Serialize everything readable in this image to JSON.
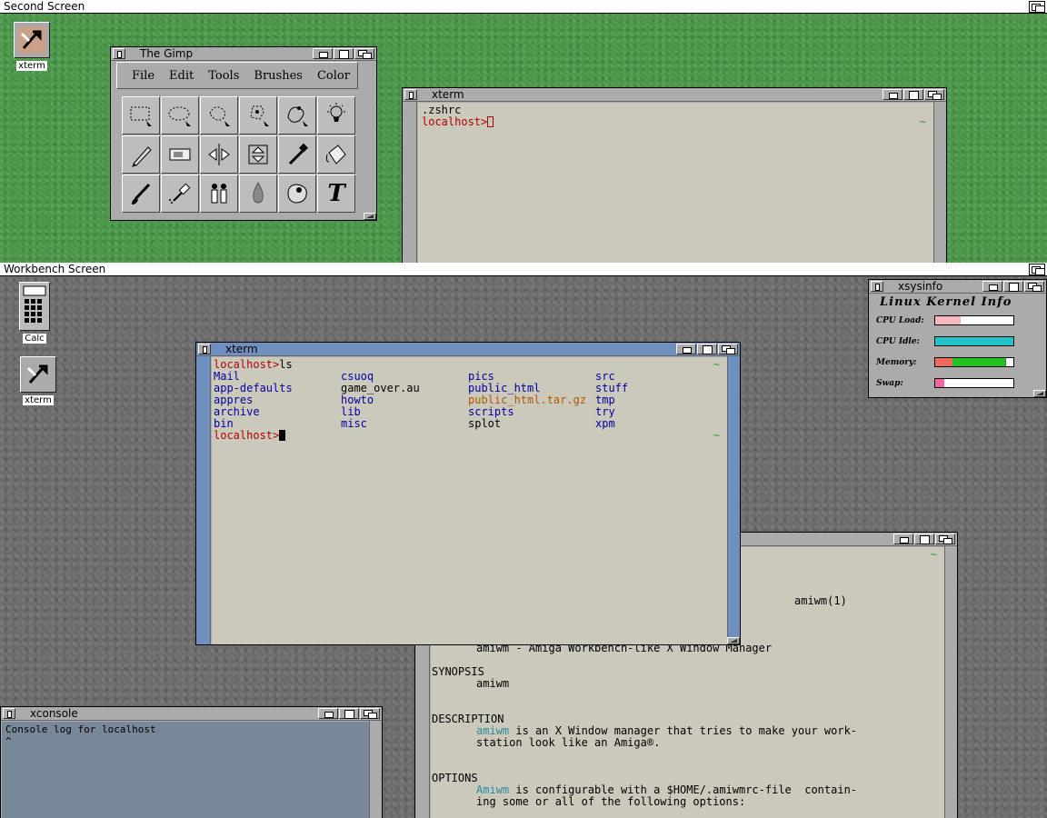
{
  "second_screen": {
    "title": "Second Screen",
    "icons": [
      {
        "label": "xterm"
      }
    ]
  },
  "workbench_screen": {
    "title": "Workbench Screen",
    "icons": [
      {
        "label": "Calc"
      },
      {
        "label": "xterm"
      }
    ]
  },
  "gimp": {
    "title": "The Gimp",
    "menu": [
      "File",
      "Edit",
      "Tools",
      "Brushes",
      "Color"
    ],
    "tools": [
      "rect-select",
      "ellipse-select",
      "free-select",
      "fuzzy-select",
      "bezier-select",
      "intelligent-scissors",
      "pencil",
      "crop",
      "flip",
      "transform",
      "color-picker",
      "bucket-fill",
      "paintbrush",
      "airbrush",
      "clone",
      "blur",
      "smudge",
      "text"
    ]
  },
  "xterm_top": {
    "title": "xterm",
    "line1": ".zshrc",
    "prompt": "localhost>",
    "tilde": "~"
  },
  "xterm_main": {
    "title": "xterm",
    "cmd_prompt": "localhost>",
    "cmd": "ls",
    "tilde": "~",
    "columns": [
      [
        {
          "t": "Mail",
          "c": "dir"
        },
        {
          "t": "app-defaults",
          "c": "dir"
        },
        {
          "t": "appres",
          "c": "dir"
        },
        {
          "t": "archive",
          "c": "dir"
        },
        {
          "t": "bin",
          "c": "dir"
        }
      ],
      [
        {
          "t": "csuoq",
          "c": "dir"
        },
        {
          "t": "game_over.au",
          "c": "file"
        },
        {
          "t": "howto",
          "c": "dir"
        },
        {
          "t": "lib",
          "c": "dir"
        },
        {
          "t": "misc",
          "c": "dir"
        }
      ],
      [
        {
          "t": "pics",
          "c": "dir"
        },
        {
          "t": "public_html",
          "c": "dir"
        },
        {
          "t": "public_html.tar.gz",
          "c": "orange"
        },
        {
          "t": "scripts",
          "c": "dir"
        },
        {
          "t": "splot",
          "c": "file"
        }
      ],
      [
        {
          "t": "src",
          "c": "dir"
        },
        {
          "t": "stuff",
          "c": "dir"
        },
        {
          "t": "tmp",
          "c": "dir"
        },
        {
          "t": "try",
          "c": "dir"
        },
        {
          "t": "xpm",
          "c": "dir"
        }
      ]
    ],
    "end_prompt": "localhost>",
    "end_tilde": "~"
  },
  "xsysinfo": {
    "title": "xsysinfo",
    "heading": "Linux Kernel Info",
    "meters": [
      {
        "label": "CPU Load:",
        "segments": [
          {
            "fraction": 0.33,
            "color": "#f6b8c0"
          }
        ]
      },
      {
        "label": "CPU Idle:",
        "segments": [
          {
            "fraction": 1.0,
            "color": "#22c4c8"
          }
        ]
      },
      {
        "label": "Memory:",
        "segments": [
          {
            "fraction": 0.22,
            "color": "#f06a5a"
          },
          {
            "fraction": 0.68,
            "color": "#22c422"
          },
          {
            "fraction": 0.01,
            "color": "#2a8a2a"
          }
        ]
      },
      {
        "label": "Swap:",
        "segments": [
          {
            "fraction": 0.12,
            "color": "#f06aa0"
          }
        ]
      }
    ]
  },
  "manpage": {
    "tilde": "~",
    "header": "amiwm(1)",
    "name_line": "amiwm - Amiga Workbench-like X Window Manager",
    "synopsis_head": "SYNOPSIS",
    "synopsis": "amiwm",
    "desc_head": "DESCRIPTION",
    "desc_word": "amiwm",
    "desc1": " is an X Window manager that tries to make your work-",
    "desc2": "station look like an Amiga®.",
    "opt_head": "OPTIONS",
    "opt_word": "Amiwm",
    "opt1": " is configurable with a $HOME/.amiwmrc-file  contain-",
    "opt2": "ing some or all of the following options:"
  },
  "xconsole": {
    "title": "xconsole",
    "line1": "Console log for localhost",
    "line2": "^"
  }
}
